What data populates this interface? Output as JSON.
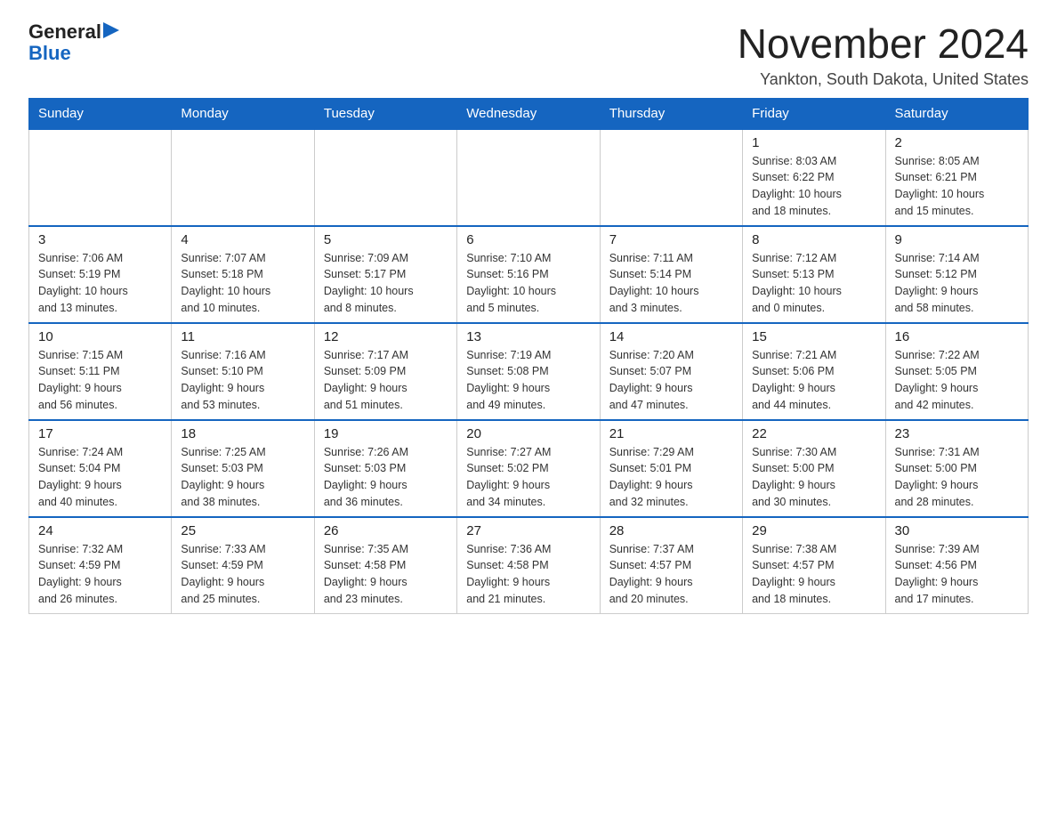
{
  "logo": {
    "general": "General",
    "blue": "Blue",
    "triangle": "▶"
  },
  "title": "November 2024",
  "subtitle": "Yankton, South Dakota, United States",
  "days_of_week": [
    "Sunday",
    "Monday",
    "Tuesday",
    "Wednesday",
    "Thursday",
    "Friday",
    "Saturday"
  ],
  "weeks": [
    [
      {
        "day": "",
        "info": ""
      },
      {
        "day": "",
        "info": ""
      },
      {
        "day": "",
        "info": ""
      },
      {
        "day": "",
        "info": ""
      },
      {
        "day": "",
        "info": ""
      },
      {
        "day": "1",
        "info": "Sunrise: 8:03 AM\nSunset: 6:22 PM\nDaylight: 10 hours\nand 18 minutes."
      },
      {
        "day": "2",
        "info": "Sunrise: 8:05 AM\nSunset: 6:21 PM\nDaylight: 10 hours\nand 15 minutes."
      }
    ],
    [
      {
        "day": "3",
        "info": "Sunrise: 7:06 AM\nSunset: 5:19 PM\nDaylight: 10 hours\nand 13 minutes."
      },
      {
        "day": "4",
        "info": "Sunrise: 7:07 AM\nSunset: 5:18 PM\nDaylight: 10 hours\nand 10 minutes."
      },
      {
        "day": "5",
        "info": "Sunrise: 7:09 AM\nSunset: 5:17 PM\nDaylight: 10 hours\nand 8 minutes."
      },
      {
        "day": "6",
        "info": "Sunrise: 7:10 AM\nSunset: 5:16 PM\nDaylight: 10 hours\nand 5 minutes."
      },
      {
        "day": "7",
        "info": "Sunrise: 7:11 AM\nSunset: 5:14 PM\nDaylight: 10 hours\nand 3 minutes."
      },
      {
        "day": "8",
        "info": "Sunrise: 7:12 AM\nSunset: 5:13 PM\nDaylight: 10 hours\nand 0 minutes."
      },
      {
        "day": "9",
        "info": "Sunrise: 7:14 AM\nSunset: 5:12 PM\nDaylight: 9 hours\nand 58 minutes."
      }
    ],
    [
      {
        "day": "10",
        "info": "Sunrise: 7:15 AM\nSunset: 5:11 PM\nDaylight: 9 hours\nand 56 minutes."
      },
      {
        "day": "11",
        "info": "Sunrise: 7:16 AM\nSunset: 5:10 PM\nDaylight: 9 hours\nand 53 minutes."
      },
      {
        "day": "12",
        "info": "Sunrise: 7:17 AM\nSunset: 5:09 PM\nDaylight: 9 hours\nand 51 minutes."
      },
      {
        "day": "13",
        "info": "Sunrise: 7:19 AM\nSunset: 5:08 PM\nDaylight: 9 hours\nand 49 minutes."
      },
      {
        "day": "14",
        "info": "Sunrise: 7:20 AM\nSunset: 5:07 PM\nDaylight: 9 hours\nand 47 minutes."
      },
      {
        "day": "15",
        "info": "Sunrise: 7:21 AM\nSunset: 5:06 PM\nDaylight: 9 hours\nand 44 minutes."
      },
      {
        "day": "16",
        "info": "Sunrise: 7:22 AM\nSunset: 5:05 PM\nDaylight: 9 hours\nand 42 minutes."
      }
    ],
    [
      {
        "day": "17",
        "info": "Sunrise: 7:24 AM\nSunset: 5:04 PM\nDaylight: 9 hours\nand 40 minutes."
      },
      {
        "day": "18",
        "info": "Sunrise: 7:25 AM\nSunset: 5:03 PM\nDaylight: 9 hours\nand 38 minutes."
      },
      {
        "day": "19",
        "info": "Sunrise: 7:26 AM\nSunset: 5:03 PM\nDaylight: 9 hours\nand 36 minutes."
      },
      {
        "day": "20",
        "info": "Sunrise: 7:27 AM\nSunset: 5:02 PM\nDaylight: 9 hours\nand 34 minutes."
      },
      {
        "day": "21",
        "info": "Sunrise: 7:29 AM\nSunset: 5:01 PM\nDaylight: 9 hours\nand 32 minutes."
      },
      {
        "day": "22",
        "info": "Sunrise: 7:30 AM\nSunset: 5:00 PM\nDaylight: 9 hours\nand 30 minutes."
      },
      {
        "day": "23",
        "info": "Sunrise: 7:31 AM\nSunset: 5:00 PM\nDaylight: 9 hours\nand 28 minutes."
      }
    ],
    [
      {
        "day": "24",
        "info": "Sunrise: 7:32 AM\nSunset: 4:59 PM\nDaylight: 9 hours\nand 26 minutes."
      },
      {
        "day": "25",
        "info": "Sunrise: 7:33 AM\nSunset: 4:59 PM\nDaylight: 9 hours\nand 25 minutes."
      },
      {
        "day": "26",
        "info": "Sunrise: 7:35 AM\nSunset: 4:58 PM\nDaylight: 9 hours\nand 23 minutes."
      },
      {
        "day": "27",
        "info": "Sunrise: 7:36 AM\nSunset: 4:58 PM\nDaylight: 9 hours\nand 21 minutes."
      },
      {
        "day": "28",
        "info": "Sunrise: 7:37 AM\nSunset: 4:57 PM\nDaylight: 9 hours\nand 20 minutes."
      },
      {
        "day": "29",
        "info": "Sunrise: 7:38 AM\nSunset: 4:57 PM\nDaylight: 9 hours\nand 18 minutes."
      },
      {
        "day": "30",
        "info": "Sunrise: 7:39 AM\nSunset: 4:56 PM\nDaylight: 9 hours\nand 17 minutes."
      }
    ]
  ]
}
